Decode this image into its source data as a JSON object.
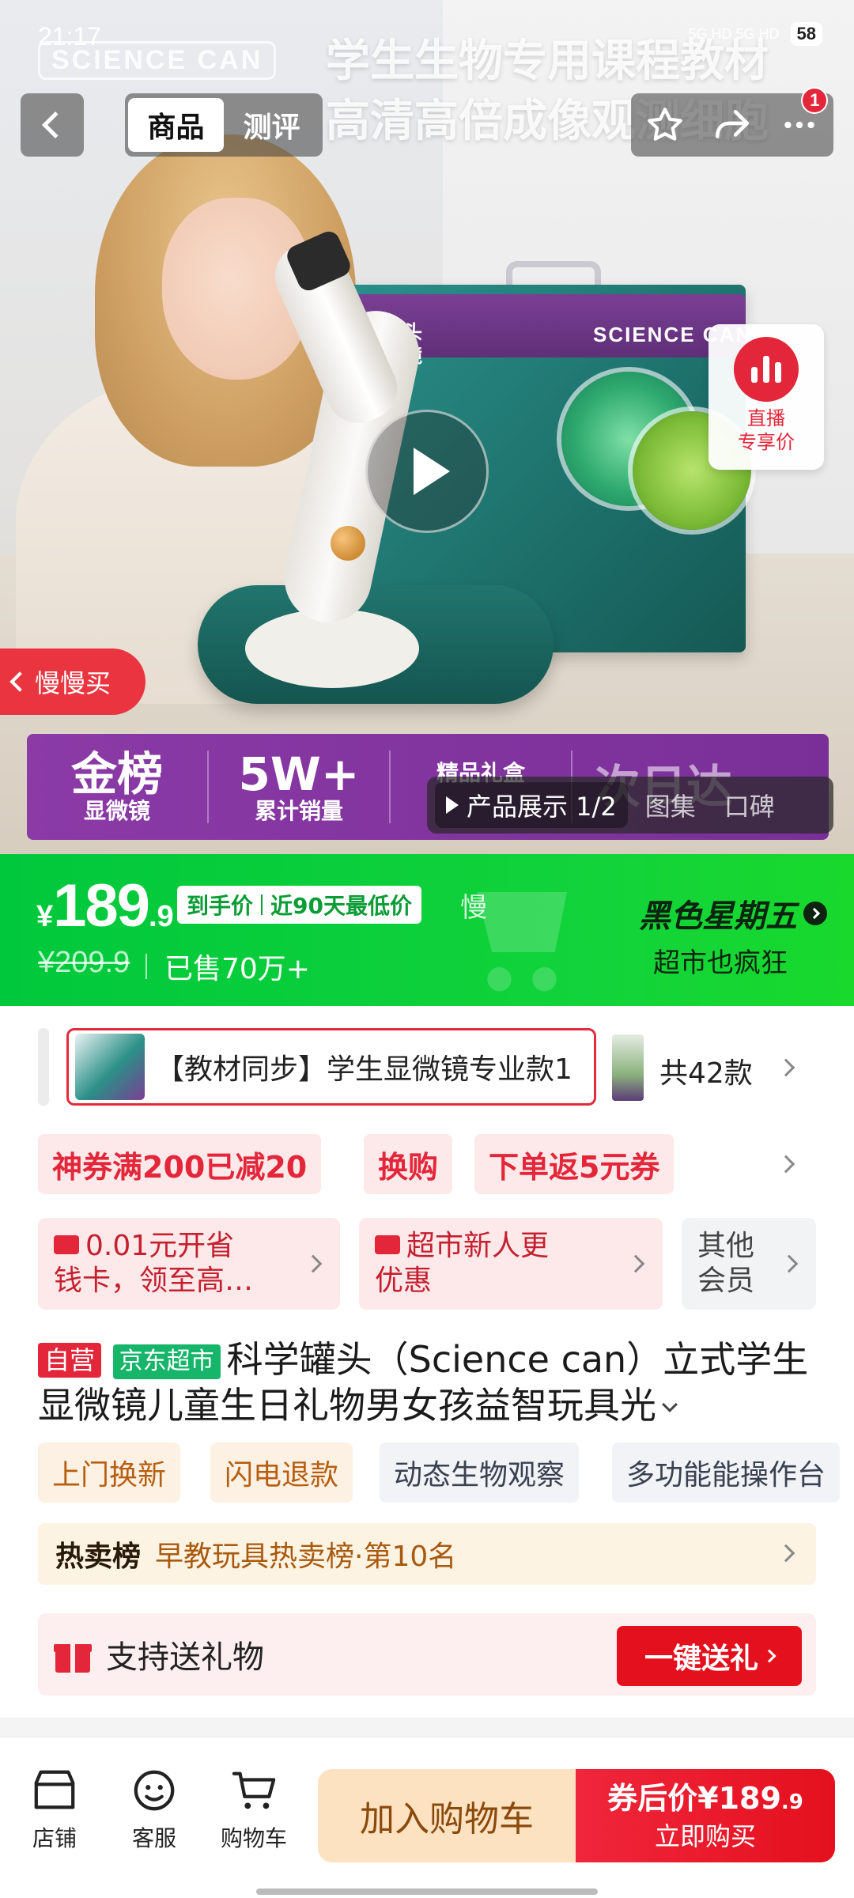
{
  "status_bar": {
    "time": "21:17",
    "network": "5G HD 5G HD",
    "battery": "58"
  },
  "hero": {
    "watermark": "SCIENCE CAN",
    "headline_line1": "学生生物专用课程教材",
    "headline_line2": "高清高倍成像观测细胞",
    "box_brand": "SCIENCE CAN",
    "box_title": "学罐头\n显微镜"
  },
  "nav": {
    "tabs": [
      {
        "label": "商品",
        "active": true
      },
      {
        "label": "测评",
        "active": false
      }
    ],
    "notification_count": "1",
    "icons": {
      "back": "chevron-left-icon",
      "favorite": "star-icon",
      "share": "share-icon",
      "more": "more-icon"
    }
  },
  "live": {
    "line1": "直播",
    "line2": "专享价"
  },
  "slow_buy": {
    "label": "慢慢买"
  },
  "band": {
    "cells": [
      {
        "big": "金榜",
        "small": "显微镜"
      },
      {
        "big": "5W+",
        "small": "累计销量"
      },
      {
        "big": "",
        "small": "精品礼盒"
      },
      {
        "big": "次日达",
        "small": ""
      }
    ]
  },
  "media_switch": {
    "video_label": "产品展示 1/2",
    "gallery_label": "图集",
    "reviews_label": "口碑"
  },
  "price": {
    "currency": "¥",
    "integer": "189",
    "decimal": ".9",
    "tag_left": "到手价",
    "tag_right": "近90天最低价",
    "tag_tail": "慢",
    "original": "¥209.9",
    "sold": "已售70万+",
    "promo_title": "黑色星期五",
    "promo_sub": "超市也疯狂"
  },
  "variant": {
    "name": "【教材同步】学生显微镜专业款1",
    "count": "共42款"
  },
  "coupons": [
    "神券满200已减20",
    "换购",
    "下单返5元券"
  ],
  "members": [
    {
      "text_line1": "0.01元开省",
      "text_line2": "钱卡，领至高…"
    },
    {
      "text_line1": "超市新人更",
      "text_line2": "优惠"
    },
    {
      "text_line1": "其他",
      "text_line2": "会员"
    }
  ],
  "product": {
    "tag_self": "自营",
    "tag_jd": "京东超市",
    "title": "科学罐头（Science can）立式学生显微镜儿童生日礼物男女孩益智玩具光"
  },
  "services": [
    "上门换新",
    "闪电退款",
    "动态生物观察",
    "多功能能操作台"
  ],
  "rank": {
    "label": "热卖榜",
    "text": "早教玩具热卖榜·第10名"
  },
  "gift": {
    "text": "支持送礼物",
    "button": "一键送礼"
  },
  "bottom": {
    "store": "店铺",
    "service": "客服",
    "cart": "购物车",
    "add_to_cart": "加入购物车",
    "buy_prefix": "券后价",
    "buy_price": "¥189",
    "buy_price_dec": ".9",
    "buy_now": "立即购买"
  }
}
